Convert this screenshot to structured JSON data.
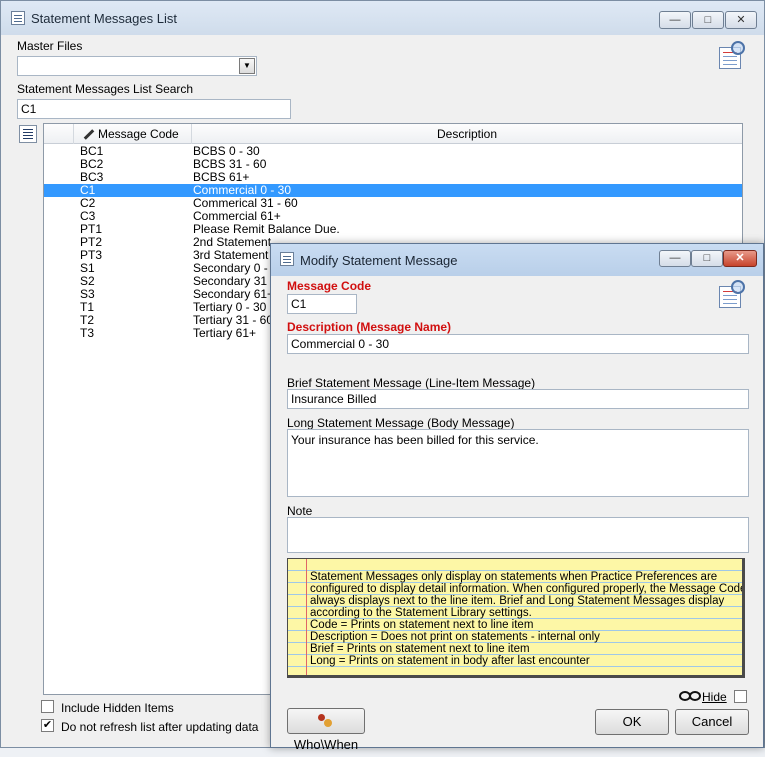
{
  "main_window": {
    "title": "Statement Messages List",
    "minimize_icon": "minimize-icon",
    "restore_icon": "restore-icon",
    "close_icon": "close-icon",
    "master_files_label": "Master Files",
    "master_files_value": "",
    "search_label": "Statement Messages List Search",
    "search_value": "C1",
    "grid": {
      "columns": [
        "Message Code",
        "Description"
      ],
      "rows": [
        {
          "code": "BC1",
          "description": "BCBS 0 - 30"
        },
        {
          "code": "BC2",
          "description": "BCBS 31 - 60"
        },
        {
          "code": "BC3",
          "description": "BCBS 61+"
        },
        {
          "code": "C1",
          "description": "Commercial 0 - 30"
        },
        {
          "code": "C2",
          "description": "Commerical 31 - 60"
        },
        {
          "code": "C3",
          "description": "Commercial 61+"
        },
        {
          "code": "PT1",
          "description": "Please Remit Balance Due."
        },
        {
          "code": "PT2",
          "description": "2nd Statement"
        },
        {
          "code": "PT3",
          "description": "3rd Statement"
        },
        {
          "code": "S1",
          "description": "Secondary 0 - 3"
        },
        {
          "code": "S2",
          "description": "Secondary 31 -"
        },
        {
          "code": "S3",
          "description": "Secondary 61+"
        },
        {
          "code": "T1",
          "description": "Tertiary 0 - 30"
        },
        {
          "code": "T2",
          "description": "Tertiary 31 - 60"
        },
        {
          "code": "T3",
          "description": "Tertiary 61+"
        }
      ],
      "selected_code": "C1"
    },
    "include_hidden_label": "Include Hidden Items",
    "include_hidden_checked": false,
    "no_refresh_label": "Do not refresh list after updating data",
    "no_refresh_checked": true
  },
  "dialog": {
    "title": "Modify Statement Message",
    "message_code_label": "Message Code",
    "message_code_value": "C1",
    "description_label": "Description (Message Name)",
    "description_value": "Commercial 0 - 30",
    "brief_label": "Brief Statement Message (Line-Item Message)",
    "brief_value": "Insurance Billed",
    "long_label": "Long Statement Message (Body Message)",
    "long_value": "Your insurance has been billed for this service.",
    "note_label": "Note",
    "note_value": "",
    "info_lines": [
      "Statement Messages only display on statements when Practice Preferences are",
      "configured to display detail information.  When configured properly, the Message Code",
      "always displays next to the line item.  Brief and Long Statement Messages display",
      "according to the Statement Library settings.",
      "Code = Prints on statement next to line item",
      "Description = Does not print on statements - internal only",
      "Brief = Prints on statement next to line item",
      "Long = Prints on statement in body after last encounter"
    ],
    "hide_label": "Hide",
    "hide_checked": false,
    "who_when_label": "Who\\When",
    "ok_label": "OK",
    "cancel_label": "Cancel"
  },
  "colors": {
    "selection": "#3399ff",
    "required_label": "#d10f0f",
    "note_paper": "#fdf7a6"
  }
}
